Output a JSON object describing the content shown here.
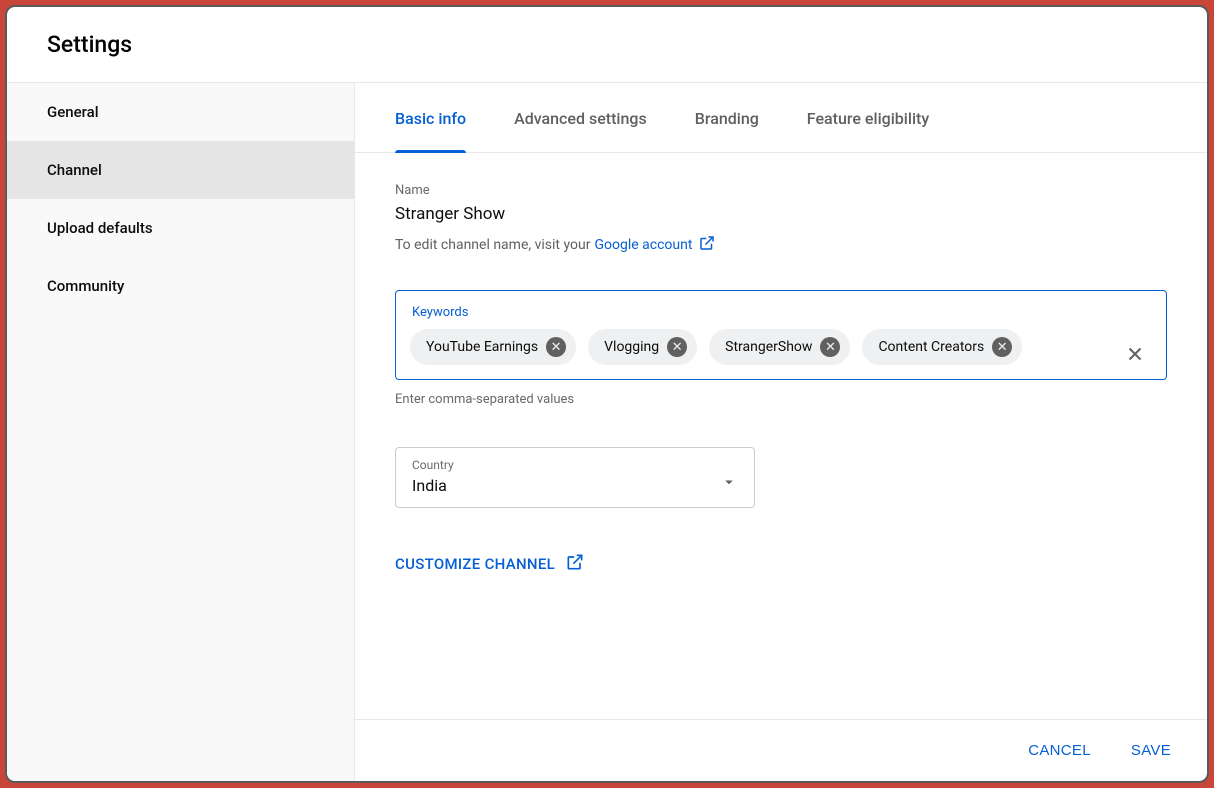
{
  "title": "Settings",
  "sidebar": {
    "items": [
      {
        "label": "General",
        "selected": false
      },
      {
        "label": "Channel",
        "selected": true
      },
      {
        "label": "Upload defaults",
        "selected": false
      },
      {
        "label": "Community",
        "selected": false
      }
    ]
  },
  "tabs": [
    {
      "label": "Basic info",
      "active": true
    },
    {
      "label": "Advanced settings",
      "active": false
    },
    {
      "label": "Branding",
      "active": false
    },
    {
      "label": "Feature eligibility",
      "active": false
    }
  ],
  "basic_info": {
    "name_label": "Name",
    "channel_name": "Stranger Show",
    "edit_help_prefix": "To edit channel name, visit your ",
    "google_account_link": "Google account",
    "keywords_label": "Keywords",
    "keywords": [
      "YouTube Earnings",
      "Vlogging",
      "StrangerShow",
      "Content Creators"
    ],
    "keywords_hint": "Enter comma-separated values",
    "country_label": "Country",
    "country_value": "India",
    "customize_channel": "CUSTOMIZE CHANNEL"
  },
  "footer": {
    "cancel": "CANCEL",
    "save": "SAVE"
  },
  "colors": {
    "accent": "#065fd4",
    "border_red": "#c9453a"
  }
}
